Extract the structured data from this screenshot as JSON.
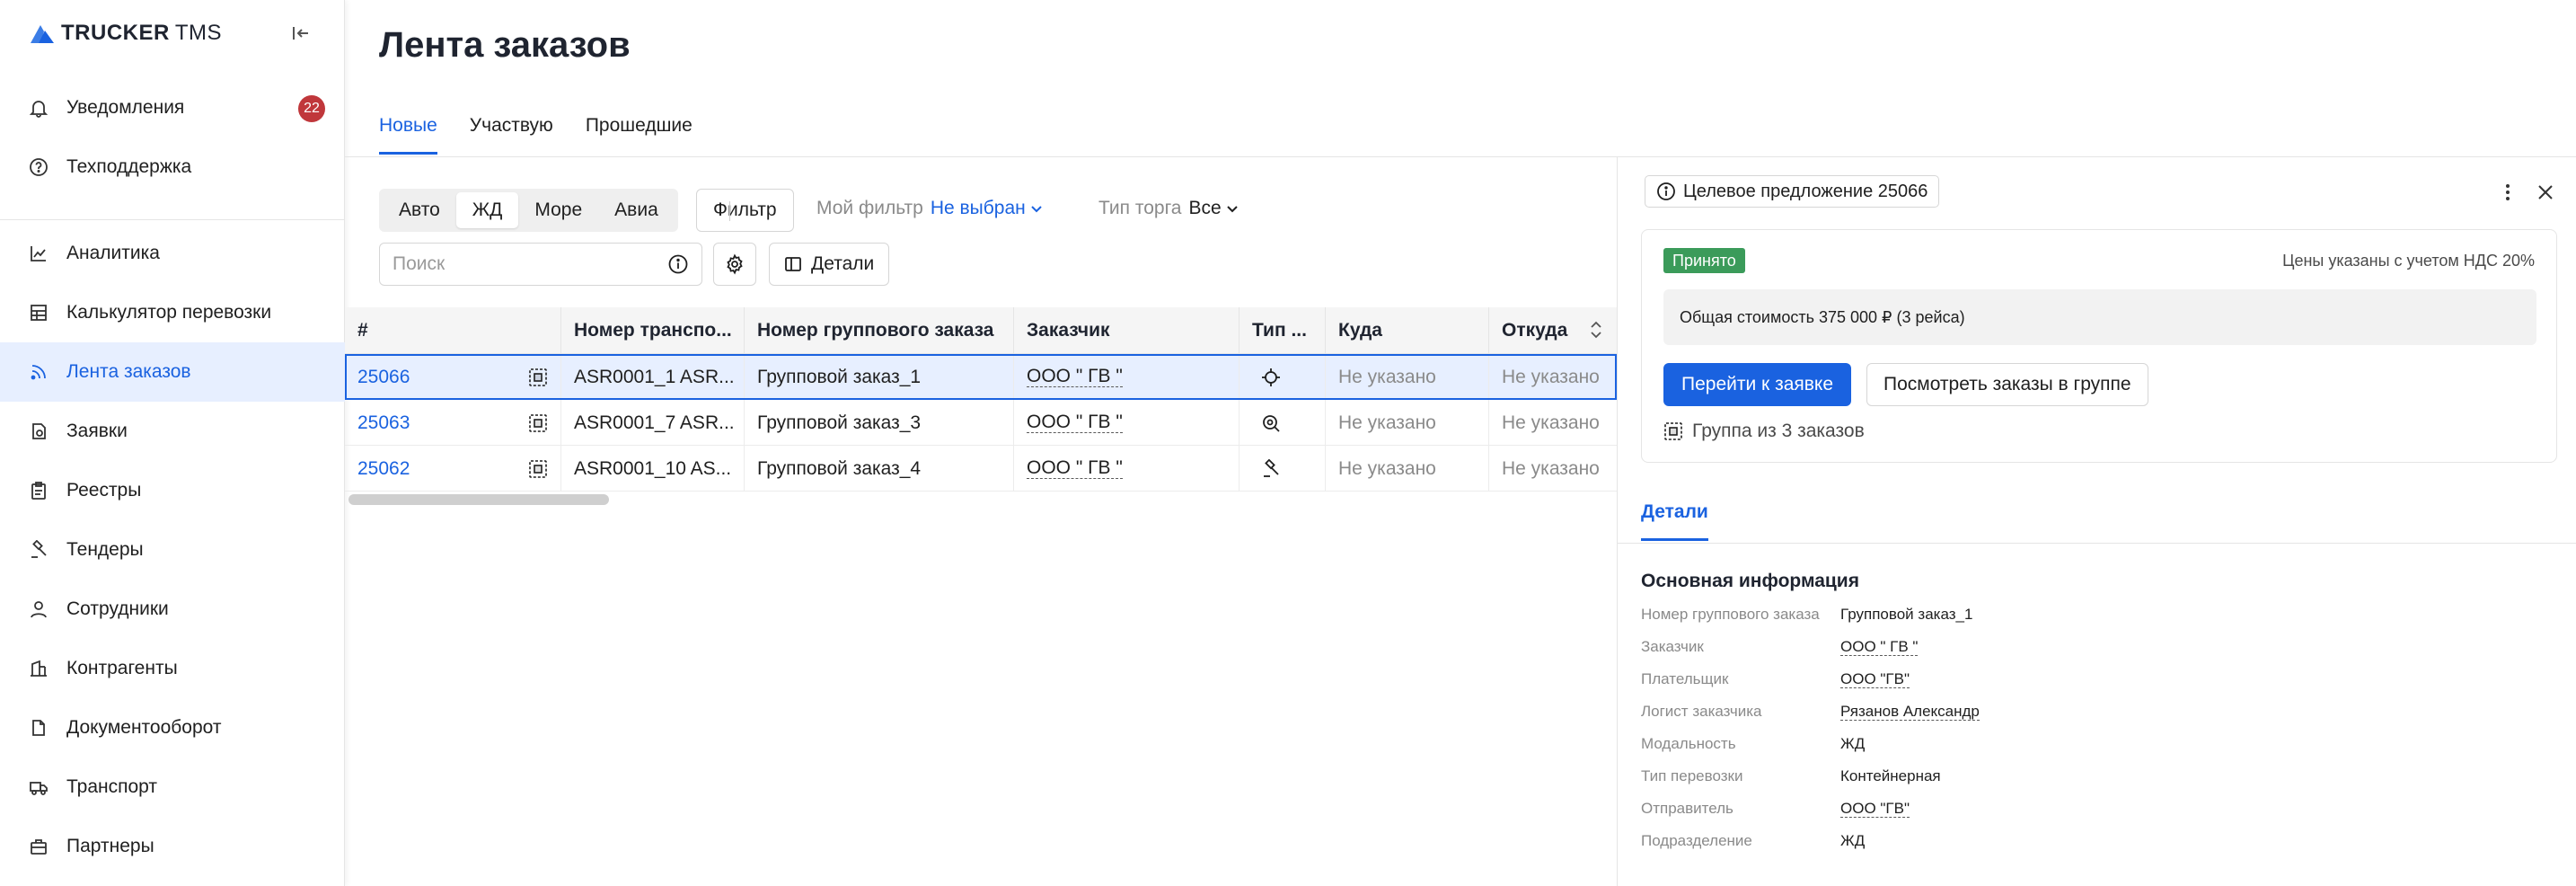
{
  "app": {
    "logo_main": "TRUCKER",
    "logo_sub": "TMS"
  },
  "sidebar": {
    "items": [
      {
        "label": "Уведомления",
        "icon": "bell-icon",
        "badge": "22"
      },
      {
        "label": "Техподдержка",
        "icon": "help-icon"
      },
      {
        "label": "Аналитика",
        "icon": "chart-icon"
      },
      {
        "label": "Калькулятор перевозки",
        "icon": "calculator-icon"
      },
      {
        "label": "Лента заказов",
        "icon": "feed-icon",
        "active": true
      },
      {
        "label": "Заявки",
        "icon": "request-icon"
      },
      {
        "label": "Реестры",
        "icon": "clipboard-icon"
      },
      {
        "label": "Тендеры",
        "icon": "gavel-icon"
      },
      {
        "label": "Сотрудники",
        "icon": "person-icon"
      },
      {
        "label": "Контрагенты",
        "icon": "bank-icon"
      },
      {
        "label": "Документооборот",
        "icon": "document-icon"
      },
      {
        "label": "Транспорт",
        "icon": "truck-icon"
      },
      {
        "label": "Партнеры",
        "icon": "briefcase-icon"
      }
    ]
  },
  "main": {
    "title": "Лента заказов",
    "tabs": [
      {
        "label": "Новые",
        "active": true
      },
      {
        "label": "Участвую"
      },
      {
        "label": "Прошедшие"
      }
    ],
    "transport": [
      "Авто",
      "ЖД",
      "Море",
      "Авиа"
    ],
    "transport_active": "ЖД",
    "filter_label": "Фильтр",
    "my_filter_label": "Мой фильтр",
    "my_filter_value": "Не выбран",
    "trade_type_label": "Тип торга",
    "trade_type_value": "Все",
    "search_placeholder": "Поиск",
    "details_label": "Детали"
  },
  "table": {
    "columns": [
      "#",
      "Номер транспо...",
      "Номер группового заказа",
      "Заказчик",
      "Тип ...",
      "Куда",
      "Откуда"
    ],
    "rows": [
      {
        "id": "25066",
        "transport_no": "ASR0001_1 ASR...",
        "group_order": "Групповой заказ_1",
        "customer": "ООО \" ГВ \"",
        "type_icon": "crosshair-icon",
        "to": "Не указано",
        "from": "Не указано",
        "selected": true
      },
      {
        "id": "25063",
        "transport_no": "ASR0001_7 ASR...",
        "group_order": "Групповой заказ_3",
        "customer": "ООО \" ГВ \"",
        "type_icon": "search-zoom-icon",
        "to": "Не указано",
        "from": "Не указано"
      },
      {
        "id": "25062",
        "transport_no": "ASR0001_10 AS...",
        "group_order": "Групповой заказ_4",
        "customer": "ООО \" ГВ \"",
        "type_icon": "gavel-icon",
        "to": "Не указано",
        "from": "Не указано"
      }
    ]
  },
  "panel": {
    "offer_label": "Целевое предложение 25066",
    "status": "Принято",
    "vat_note": "Цены указаны с учетом НДС 20%",
    "total": "Общая стоимость 375 000 ₽ (3 рейса)",
    "go_button": "Перейти к заявке",
    "view_group_button": "Посмотреть заказы в группе",
    "group_link": "Группа из 3 заказов",
    "details_tab": "Детали",
    "section_title": "Основная информация",
    "info": [
      {
        "k": "Номер группового заказа",
        "v": "Групповой заказ_1",
        "dotted": false
      },
      {
        "k": "Заказчик",
        "v": "ООО \" ГВ \"",
        "dotted": true
      },
      {
        "k": "Плательщик",
        "v": "ООО \"ГВ\"",
        "dotted": true
      },
      {
        "k": "Логист заказчика",
        "v": "Рязанов Александр",
        "dotted": true
      },
      {
        "k": "Модальность",
        "v": "ЖД",
        "dotted": false
      },
      {
        "k": "Тип перевозки",
        "v": "Контейнерная",
        "dotted": false
      },
      {
        "k": "Отправитель",
        "v": "ООО \"ГВ\"",
        "dotted": true
      },
      {
        "k": "Подразделение",
        "v": "ЖД",
        "dotted": false
      }
    ]
  },
  "colors": {
    "accent": "#1a62e0",
    "badge": "#c0373b",
    "status_ok": "#3b9b5a",
    "active_bg": "#e7efff"
  }
}
